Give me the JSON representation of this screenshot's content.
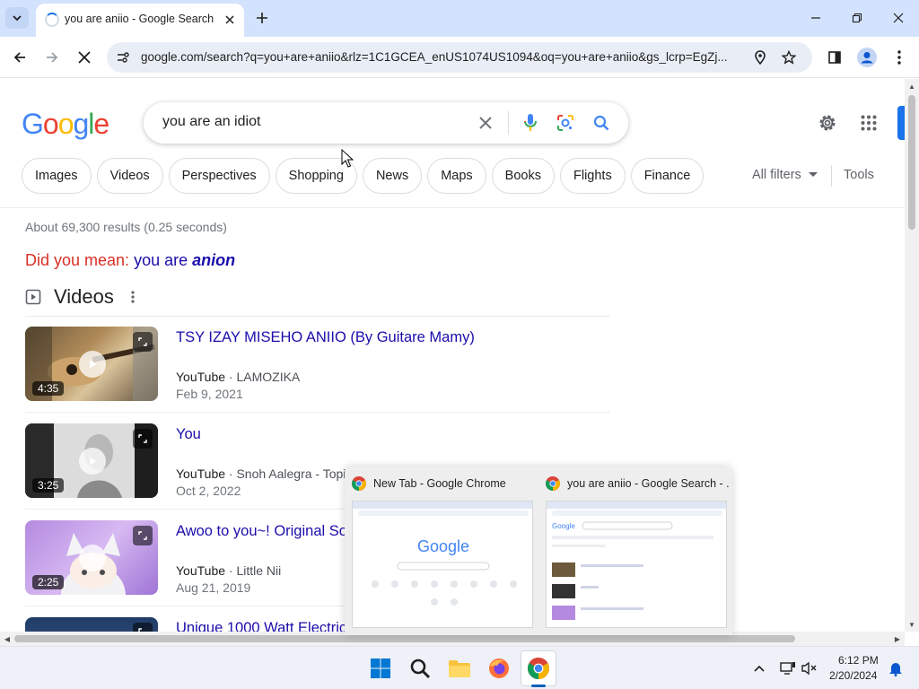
{
  "browser": {
    "tab": {
      "title": "you are aniio - Google Search"
    },
    "url": "google.com/search?q=you+are+aniio&rlz=1C1GCEA_enUS1074US1094&oq=you+are+aniio&gs_lcrp=EgZj..."
  },
  "google": {
    "logo": [
      "G",
      "o",
      "o",
      "g",
      "l",
      "e"
    ],
    "logo_colors": [
      "#4285F4",
      "#EA4335",
      "#FBBC05",
      "#4285F4",
      "#34A853",
      "#EA4335"
    ],
    "search_query": "you are an idiot",
    "chips": [
      "Images",
      "Videos",
      "Perspectives",
      "Shopping",
      "News",
      "Maps",
      "Books",
      "Flights",
      "Finance"
    ],
    "all_filters": "All filters",
    "tools": "Tools",
    "result_stats": "About 69,300 results (0.25 seconds)",
    "did_you_mean": {
      "label": "Did you mean:",
      "plain": "you are",
      "emphasis": "anion"
    },
    "videos": {
      "title": "Videos",
      "items": [
        {
          "title": "TSY IZAY MISEHO ANIIO (By Guitare Mamy)",
          "source": "YouTube",
          "channel": "LAMOZIKA",
          "date": "Feb 9, 2021",
          "duration": "4:35"
        },
        {
          "title": "You",
          "source": "YouTube",
          "channel": "Snoh Aalegra - Topi",
          "date": "Oct 2, 2022",
          "duration": "3:25"
        },
        {
          "title": "Awoo to you~! Original Sor",
          "source": "YouTube",
          "channel": "Little Nii",
          "date": "Aug 21, 2019",
          "duration": "2:25"
        },
        {
          "title": "Unique 1000 Watt Electric"
        }
      ]
    }
  },
  "previews": [
    {
      "title": "New Tab - Google Chrome"
    },
    {
      "title": "you are aniio - Google Search - ..."
    }
  ],
  "taskbar": {
    "time": "6:12 PM",
    "date": "2/20/2024"
  }
}
